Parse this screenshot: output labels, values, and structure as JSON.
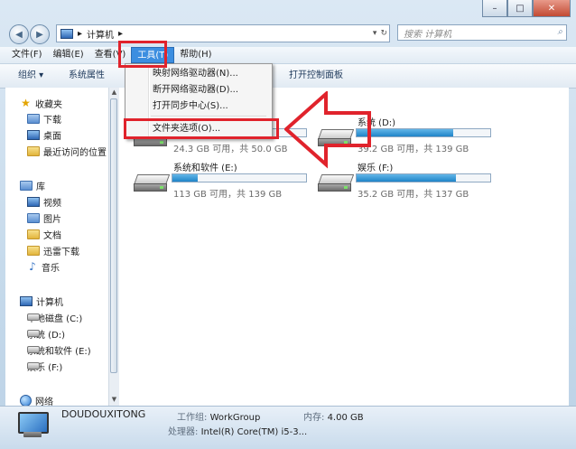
{
  "window": {
    "controls": [
      "–",
      "□",
      "✕"
    ]
  },
  "address": {
    "crumb": "计算机",
    "search_placeholder": "搜索 计算机"
  },
  "menubar": {
    "items": [
      "文件(F)",
      "编辑(E)",
      "查看(V)",
      "工具(T)",
      "帮助(H)"
    ],
    "active_index": 3
  },
  "toolbar": {
    "organize": "组织 ▾",
    "system_properties": "系统属性",
    "control_panel": "打开控制面板"
  },
  "tools_menu": {
    "items": [
      "映射网络驱动器(N)...",
      "断开网络驱动器(D)...",
      "打开同步中心(S)...",
      "文件夹选项(O)..."
    ],
    "highlighted_index": 3
  },
  "sidebar": {
    "favorites": {
      "label": "收藏夹",
      "items": [
        "下载",
        "桌面",
        "最近访问的位置"
      ]
    },
    "libraries": {
      "label": "库",
      "items": [
        "视频",
        "图片",
        "文档",
        "迅雷下载",
        "音乐"
      ]
    },
    "computer": {
      "label": "计算机",
      "items": [
        "本地磁盘 (C:)",
        "系统 (D:)",
        "系统和软件 (E:)",
        "娱乐 (F:)"
      ]
    },
    "network": {
      "label": "网络"
    }
  },
  "drives": [
    {
      "name": "",
      "size": "24.3 GB 可用，共 50.0 GB",
      "used_fraction": 0.51
    },
    {
      "name": "系统 (D:)",
      "size": "39.2 GB 可用，共 139 GB",
      "used_fraction": 0.72
    },
    {
      "name": "系统和软件 (E:)",
      "size": "113 GB 可用，共 139 GB",
      "used_fraction": 0.19
    },
    {
      "name": "娱乐 (F:)",
      "size": "35.2 GB 可用，共 137 GB",
      "used_fraction": 0.74
    }
  ],
  "status": {
    "computer_name": "DOUDOUXITONG",
    "workgroup_label": "工作组:",
    "workgroup": "WorkGroup",
    "memory_label": "内存:",
    "memory": "4.00 GB",
    "cpu_label": "处理器:",
    "cpu": "Intel(R) Core(TM) i5-3..."
  },
  "colors": {
    "highlight_box": "#e0232c",
    "menu_active": "#3c8ee0",
    "drive_bar": "#1f84c8"
  }
}
